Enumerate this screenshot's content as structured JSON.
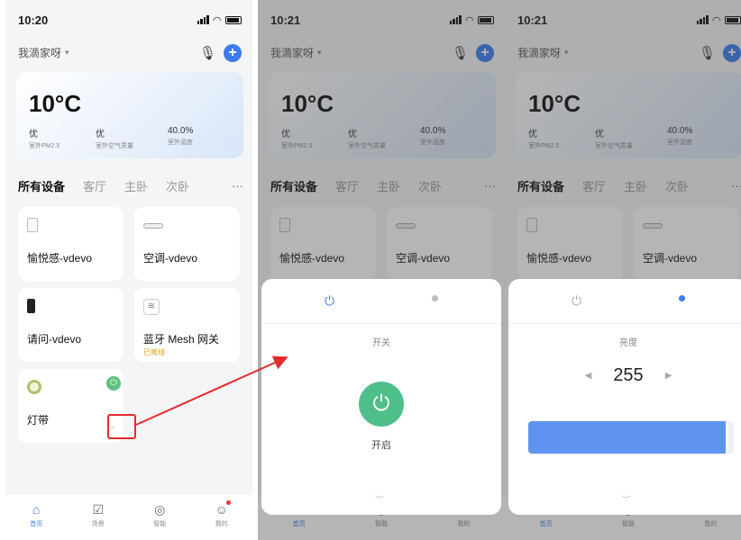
{
  "screens": [
    {
      "time": "10:20",
      "home_name": "我滴家呀"
    },
    {
      "time": "10:21",
      "home_name": "我滴家呀"
    },
    {
      "time": "10:21",
      "home_name": "我滴家呀"
    }
  ],
  "weather": {
    "temperature": "10°C",
    "stats": [
      {
        "value": "优",
        "label": "室外PM2.5"
      },
      {
        "value": "优",
        "label": "室外空气质量"
      },
      {
        "value": "40.0%",
        "label": "室外湿度"
      }
    ]
  },
  "room_tabs": [
    "所有设备",
    "客厅",
    "主卧",
    "次卧"
  ],
  "more_glyph": "···",
  "devices": [
    {
      "name": "愉悦感-vdevo",
      "icon": "sensor-icon"
    },
    {
      "name": "空调-vdevo",
      "icon": "air-conditioner-icon"
    },
    {
      "name": "请问-vdevo",
      "icon": "phone-device-icon"
    },
    {
      "name": "蓝牙 Mesh 网关",
      "icon": "wifi-gateway-icon",
      "status": "已离线"
    },
    {
      "name": "灯带",
      "icon": "light-strip-icon"
    }
  ],
  "tabbar": [
    {
      "label": "首页",
      "icon": "home-icon"
    },
    {
      "label": "场景",
      "icon": "scene-icon"
    },
    {
      "label": "智能",
      "icon": "smart-icon"
    },
    {
      "label": "我的",
      "icon": "profile-icon"
    }
  ],
  "switch_panel": {
    "title": "开关",
    "state_label": "开启"
  },
  "brightness_panel": {
    "title": "亮度",
    "value": "255",
    "level_fraction": 0.96
  },
  "colors": {
    "accent": "#3d7cf0",
    "power_green": "#4fbf8a",
    "annotation_red": "#e32b2b"
  }
}
